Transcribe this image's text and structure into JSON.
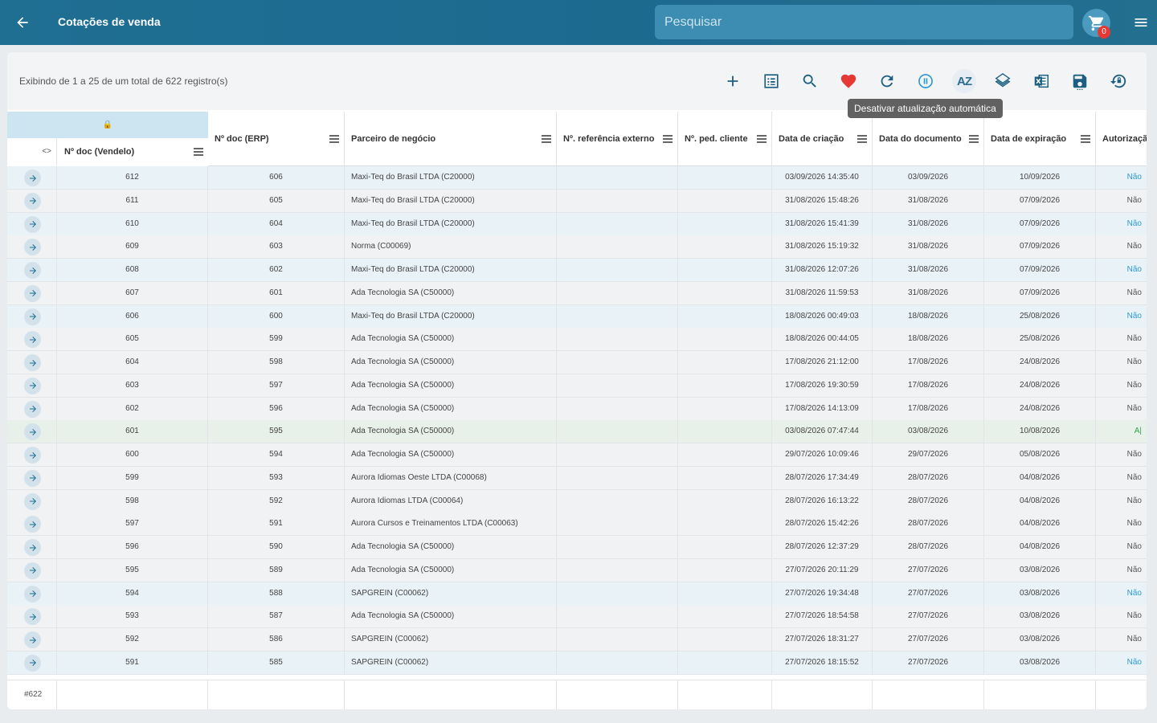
{
  "header": {
    "title": "Cotações de venda",
    "search_placeholder": "Pesquisar",
    "cart_count": "0"
  },
  "toolbar": {
    "records_info": "Exibindo de 1 a 25 de um total de 622 registro(s)",
    "tooltip": "Desativar atualização automática",
    "tools": [
      "add-icon",
      "list-icon",
      "search-icon",
      "heart-icon",
      "refresh-icon",
      "pause-icon",
      "sort-az-icon",
      "layers-icon",
      "excel-icon",
      "save-icon",
      "restore-icon"
    ],
    "tool_az_label": "AZ"
  },
  "grid": {
    "lock_glyph": "🔒",
    "expand_glyph": "<>",
    "columns": [
      "Nº doc (Vendelo)",
      "Nº doc (ERP)",
      "Parceiro de negócio",
      "Nº. referência externo",
      "Nº. ped. cliente",
      "Data de criação",
      "Data do documento",
      "Data de expiração",
      "Autorização"
    ],
    "rows": [
      {
        "vendelo": "612",
        "erp": "606",
        "partner": "Maxi-Teq do Brasil LTDA (C20000)",
        "created": "03/09/2026 14:35:40",
        "doc_date": "03/09/2026",
        "exp_date": "10/09/2026",
        "auth": "Não",
        "auth_color": "blue",
        "style": "even"
      },
      {
        "vendelo": "611",
        "erp": "605",
        "partner": "Maxi-Teq do Brasil LTDA (C20000)",
        "created": "31/08/2026 15:48:26",
        "doc_date": "31/08/2026",
        "exp_date": "07/09/2026",
        "auth": "Não",
        "auth_color": "grey",
        "style": "odd"
      },
      {
        "vendelo": "610",
        "erp": "604",
        "partner": "Maxi-Teq do Brasil LTDA (C20000)",
        "created": "31/08/2026 15:41:39",
        "doc_date": "31/08/2026",
        "exp_date": "07/09/2026",
        "auth": "Não",
        "auth_color": "blue",
        "style": "even"
      },
      {
        "vendelo": "609",
        "erp": "603",
        "partner": "Norma (C00069)",
        "created": "31/08/2026 15:19:32",
        "doc_date": "31/08/2026",
        "exp_date": "07/09/2026",
        "auth": "Não",
        "auth_color": "grey",
        "style": "odd"
      },
      {
        "vendelo": "608",
        "erp": "602",
        "partner": "Maxi-Teq do Brasil LTDA (C20000)",
        "created": "31/08/2026 12:07:26",
        "doc_date": "31/08/2026",
        "exp_date": "07/09/2026",
        "auth": "Não",
        "auth_color": "blue",
        "style": "even"
      },
      {
        "vendelo": "607",
        "erp": "601",
        "partner": "Ada Tecnologia SA (C50000)",
        "created": "31/08/2026 11:59:53",
        "doc_date": "31/08/2026",
        "exp_date": "07/09/2026",
        "auth": "Não",
        "auth_color": "grey",
        "style": "odd"
      },
      {
        "vendelo": "606",
        "erp": "600",
        "partner": "Maxi-Teq do Brasil LTDA (C20000)",
        "created": "18/08/2026 00:49:03",
        "doc_date": "18/08/2026",
        "exp_date": "25/08/2026",
        "auth": "Não",
        "auth_color": "blue",
        "style": "even"
      },
      {
        "vendelo": "605",
        "erp": "599",
        "partner": "Ada Tecnologia SA (C50000)",
        "created": "18/08/2026 00:44:05",
        "doc_date": "18/08/2026",
        "exp_date": "25/08/2026",
        "auth": "Não",
        "auth_color": "grey",
        "style": "odd"
      },
      {
        "vendelo": "604",
        "erp": "598",
        "partner": "Ada Tecnologia SA (C50000)",
        "created": "17/08/2026 21:12:00",
        "doc_date": "17/08/2026",
        "exp_date": "24/08/2026",
        "auth": "Não",
        "auth_color": "grey",
        "style": "odd"
      },
      {
        "vendelo": "603",
        "erp": "597",
        "partner": "Ada Tecnologia SA (C50000)",
        "created": "17/08/2026 19:30:59",
        "doc_date": "17/08/2026",
        "exp_date": "24/08/2026",
        "auth": "Não",
        "auth_color": "grey",
        "style": "odd"
      },
      {
        "vendelo": "602",
        "erp": "596",
        "partner": "Ada Tecnologia SA (C50000)",
        "created": "17/08/2026 14:13:09",
        "doc_date": "17/08/2026",
        "exp_date": "24/08/2026",
        "auth": "Não",
        "auth_color": "grey",
        "style": "odd"
      },
      {
        "vendelo": "601",
        "erp": "595",
        "partner": "Ada Tecnologia SA (C50000)",
        "created": "03/08/2026 07:47:44",
        "doc_date": "03/08/2026",
        "exp_date": "10/08/2026",
        "auth": "A|",
        "auth_color": "green",
        "style": "green"
      },
      {
        "vendelo": "600",
        "erp": "594",
        "partner": "Ada Tecnologia SA (C50000)",
        "created": "29/07/2026 10:09:46",
        "doc_date": "29/07/2026",
        "exp_date": "05/08/2026",
        "auth": "Não",
        "auth_color": "grey",
        "style": "odd"
      },
      {
        "vendelo": "599",
        "erp": "593",
        "partner": "Aurora Idiomas Oeste LTDA (C00068)",
        "created": "28/07/2026 17:34:49",
        "doc_date": "28/07/2026",
        "exp_date": "04/08/2026",
        "auth": "Não",
        "auth_color": "grey",
        "style": "odd"
      },
      {
        "vendelo": "598",
        "erp": "592",
        "partner": "Aurora Idiomas LTDA (C00064)",
        "created": "28/07/2026 16:13:22",
        "doc_date": "28/07/2026",
        "exp_date": "04/08/2026",
        "auth": "Não",
        "auth_color": "grey",
        "style": "odd"
      },
      {
        "vendelo": "597",
        "erp": "591",
        "partner": "Aurora Cursos e Treinamentos LTDA (C00063)",
        "created": "28/07/2026 15:42:26",
        "doc_date": "28/07/2026",
        "exp_date": "04/08/2026",
        "auth": "Não",
        "auth_color": "grey",
        "style": "odd"
      },
      {
        "vendelo": "596",
        "erp": "590",
        "partner": "Ada Tecnologia SA (C50000)",
        "created": "28/07/2026 12:37:29",
        "doc_date": "28/07/2026",
        "exp_date": "04/08/2026",
        "auth": "Não",
        "auth_color": "grey",
        "style": "odd"
      },
      {
        "vendelo": "595",
        "erp": "589",
        "partner": "Ada Tecnologia SA (C50000)",
        "created": "27/07/2026 20:11:29",
        "doc_date": "27/07/2026",
        "exp_date": "03/08/2026",
        "auth": "Não",
        "auth_color": "grey",
        "style": "odd"
      },
      {
        "vendelo": "594",
        "erp": "588",
        "partner": "SAPGREIN (C00062)",
        "created": "27/07/2026 19:34:48",
        "doc_date": "27/07/2026",
        "exp_date": "03/08/2026",
        "auth": "Não",
        "auth_color": "blue",
        "style": "even"
      },
      {
        "vendelo": "593",
        "erp": "587",
        "partner": "Ada Tecnologia SA (C50000)",
        "created": "27/07/2026 18:54:58",
        "doc_date": "27/07/2026",
        "exp_date": "03/08/2026",
        "auth": "Não",
        "auth_color": "grey",
        "style": "odd"
      },
      {
        "vendelo": "592",
        "erp": "586",
        "partner": "SAPGREIN (C00062)",
        "created": "27/07/2026 18:31:27",
        "doc_date": "27/07/2026",
        "exp_date": "03/08/2026",
        "auth": "Não",
        "auth_color": "grey",
        "style": "odd"
      },
      {
        "vendelo": "591",
        "erp": "585",
        "partner": "SAPGREIN (C00062)",
        "created": "27/07/2026 18:15:52",
        "doc_date": "27/07/2026",
        "exp_date": "03/08/2026",
        "auth": "Não",
        "auth_color": "blue",
        "style": "even"
      }
    ],
    "footer_count": "#622"
  },
  "colors": {
    "header_bg": "#1f6f93",
    "accent": "#2c9ad1",
    "favorite": "#e53935",
    "approved": "#2aa44a"
  }
}
